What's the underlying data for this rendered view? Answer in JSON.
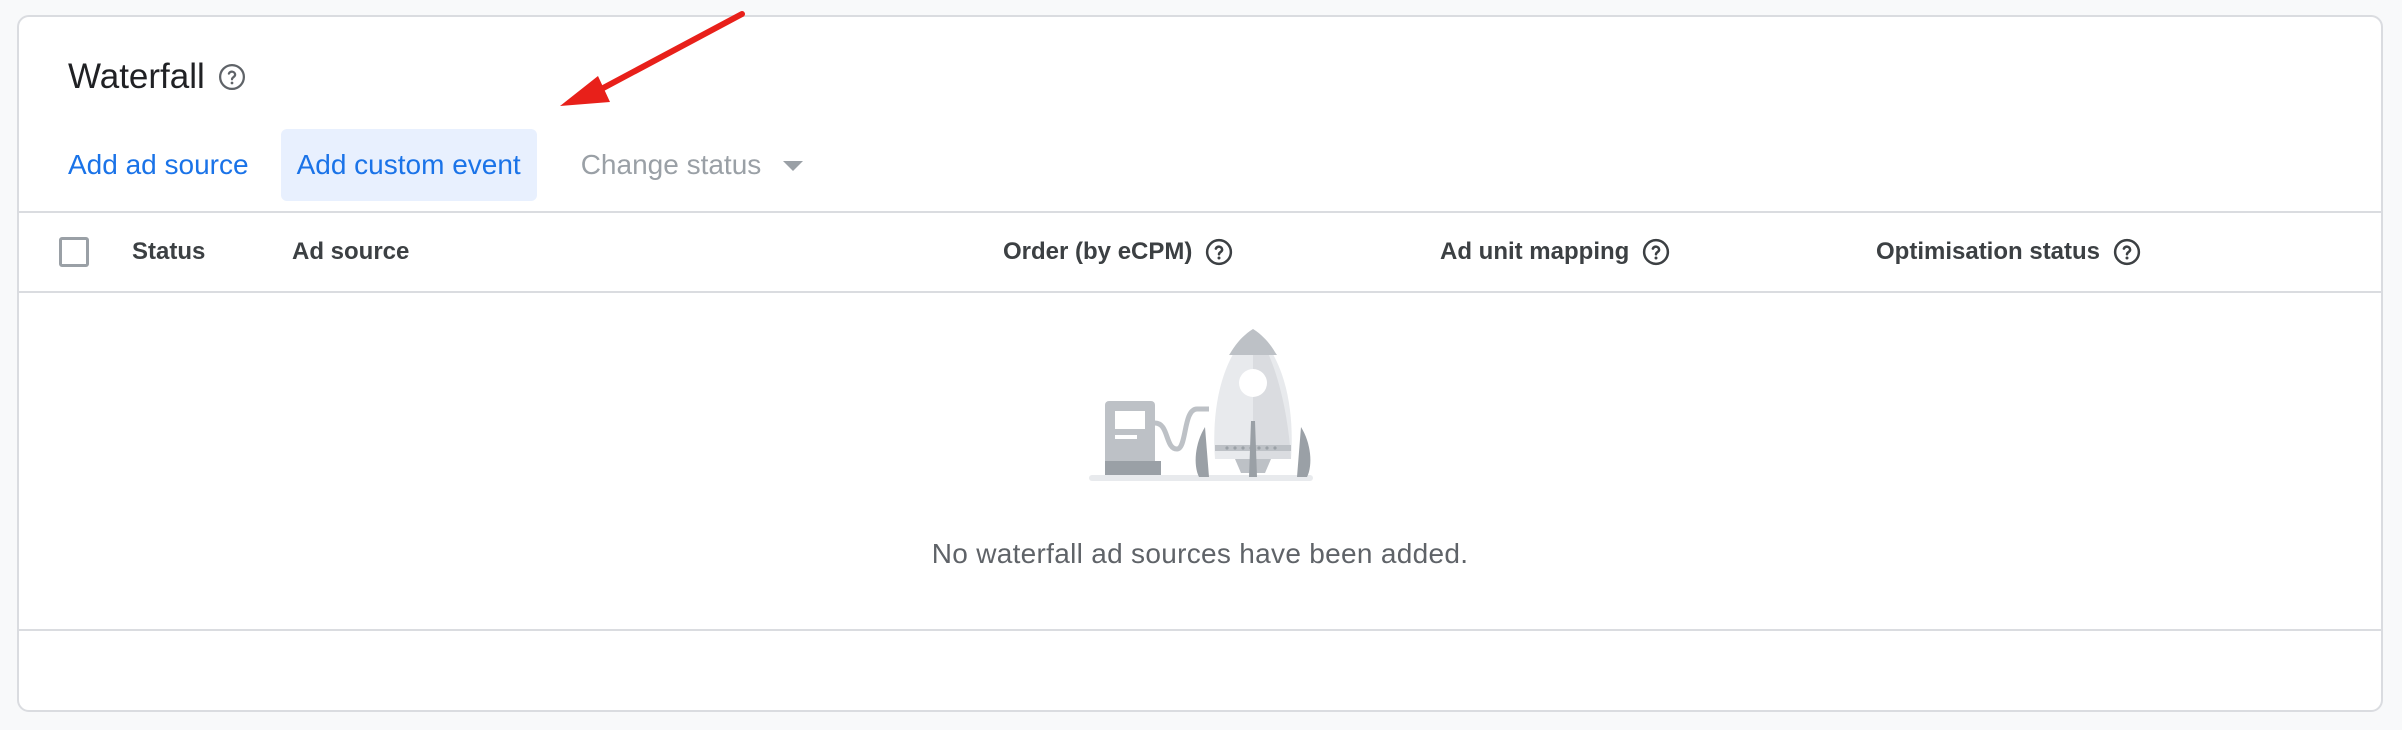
{
  "card": {
    "title": "Waterfall",
    "title_help_icon": "help-circle-icon"
  },
  "toolbar": {
    "add_ad_source": "Add ad source",
    "add_custom_event": "Add custom event",
    "change_status": "Change status",
    "change_status_icon": "caret-down-icon"
  },
  "table": {
    "columns": [
      {
        "label": "Status",
        "help": false
      },
      {
        "label": "Ad source",
        "help": false
      },
      {
        "label": "Order (by eCPM)",
        "help": true
      },
      {
        "label": "Ad unit mapping",
        "help": true
      },
      {
        "label": "Optimisation status",
        "help": true
      }
    ]
  },
  "empty_state": {
    "illustration": "rocket-fuel-pump-illustration",
    "message": "No waterfall ad sources have been added."
  },
  "annotation": {
    "type": "red-arrow",
    "color": "#e8201a"
  },
  "colors": {
    "link_blue": "#1a73e8",
    "active_bg": "#e8f0fe",
    "disabled": "#9aa0a6",
    "border": "#dadce0"
  }
}
